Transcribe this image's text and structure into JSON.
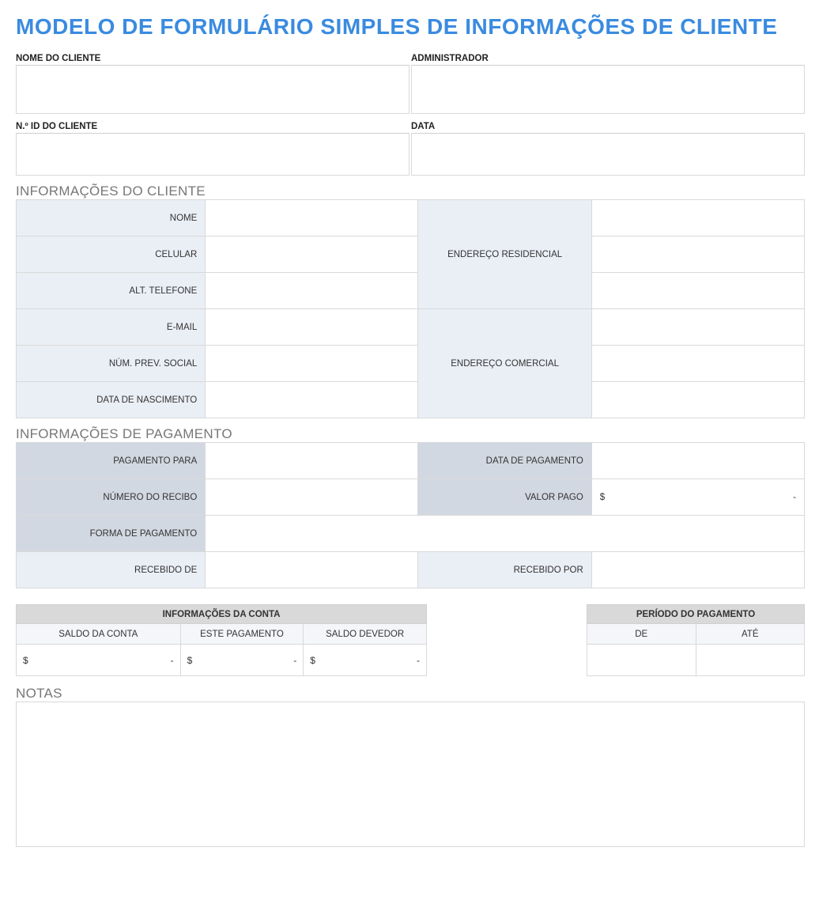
{
  "title": "MODELO DE FORMULÁRIO SIMPLES DE INFORMAÇÕES DE CLIENTE",
  "header": {
    "client_name_label": "NOME DO CLIENTE",
    "client_name_value": "",
    "admin_label": "ADMINISTRADOR",
    "admin_value": "",
    "client_id_label": "N.º ID DO CLIENTE",
    "client_id_value": "",
    "date_label": "DATA",
    "date_value": ""
  },
  "client_info": {
    "heading": "INFORMAÇÕES DO CLIENTE",
    "rows": {
      "nome_label": "NOME",
      "nome_value": "",
      "celular_label": "CELULAR",
      "celular_value": "",
      "alt_label": "ALT. TELEFONE",
      "alt_value": "",
      "email_label": "E-MAIL",
      "email_value": "",
      "ssn_label": "NÚM. PREV. SOCIAL",
      "ssn_value": "",
      "dob_label": "DATA DE NASCIMENTO",
      "dob_value": "",
      "home_addr_label": "ENDEREÇO RESIDENCIAL",
      "home_addr_v1": "",
      "home_addr_v2": "",
      "home_addr_v3": "",
      "work_addr_label": "ENDEREÇO COMERCIAL",
      "work_addr_v1": "",
      "work_addr_v2": "",
      "work_addr_v3": ""
    }
  },
  "payment_info": {
    "heading": "INFORMAÇÕES DE PAGAMENTO",
    "pay_to_label": "PAGAMENTO PARA",
    "pay_to_value": "",
    "pay_date_label": "DATA DE PAGAMENTO",
    "pay_date_value": "",
    "receipt_label": "NÚMERO DO RECIBO",
    "receipt_value": "",
    "amount_label": "VALOR PAGO",
    "amount_currency": "$",
    "amount_value": "-",
    "method_label": "FORMA DE PAGAMENTO",
    "method_value": "",
    "from_label": "RECEBIDO DE",
    "from_value": "",
    "by_label": "RECEBIDO POR",
    "by_value": ""
  },
  "account_info": {
    "heading": "INFORMAÇÕES DA CONTA",
    "cols": {
      "balance_label": "SALDO DA CONTA",
      "balance_currency": "$",
      "balance_value": "-",
      "this_pay_label": "ESTE PAGAMENTO",
      "this_pay_currency": "$",
      "this_pay_value": "-",
      "due_label": "SALDO DEVEDOR",
      "due_currency": "$",
      "due_value": "-"
    }
  },
  "pay_period": {
    "heading": "PERÍODO DO PAGAMENTO",
    "from_label": "DE",
    "from_value": "",
    "to_label": "ATÉ",
    "to_value": ""
  },
  "notes": {
    "heading": "NOTAS",
    "value": ""
  }
}
